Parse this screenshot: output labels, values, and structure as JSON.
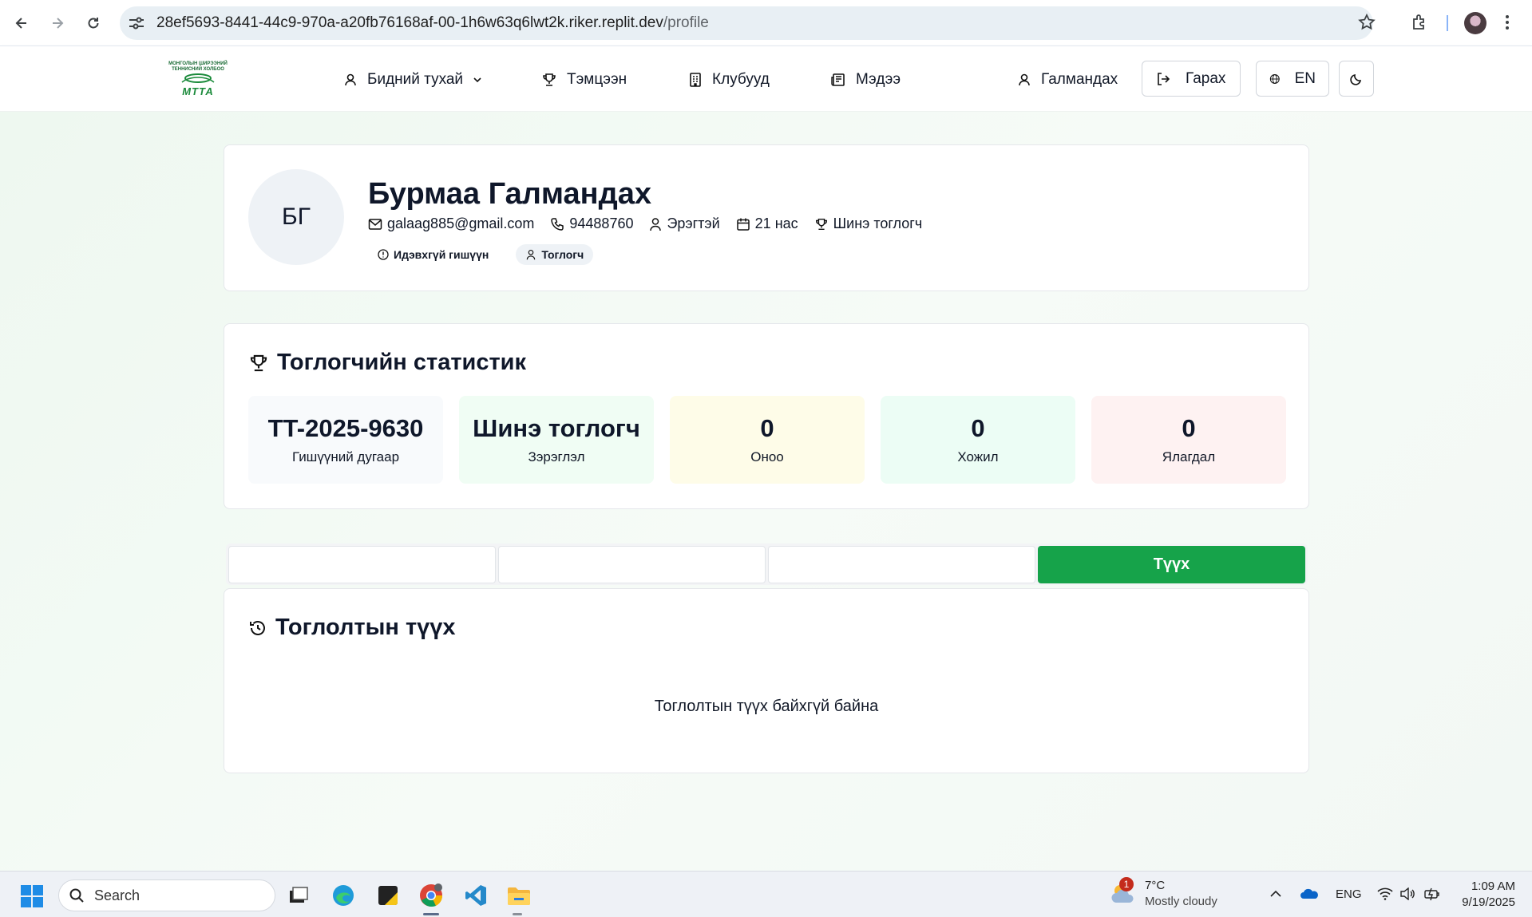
{
  "browser": {
    "url_host": "28ef5693-8441-44c9-970a-a20fb76168af-00-1h6w63q6lwt2k.riker.replit.dev",
    "url_path": "/profile"
  },
  "site": {
    "logo_text_line1": "МОНГОЛЫН ШИРЭЭНИЙ",
    "logo_text_line2": "ТЕННИСНИЙ ХОЛБОО",
    "logo_mark": "МТТА",
    "menu": {
      "about": "Бидний тухай",
      "tournaments": "Тэмцээн",
      "clubs": "Клубууд",
      "news": "Мэдээ"
    },
    "user_name": "Галмандах",
    "logout": "Гарах",
    "language": "EN"
  },
  "profile": {
    "initials": "БГ",
    "full_name": "Бурмаа Галмандах",
    "email": "galaag885@gmail.com",
    "phone": "94488760",
    "gender": "Эрэгтэй",
    "age": "21 нас",
    "rank": "Шинэ тоглогч",
    "status_badge": "Идэвхгүй гишүүн",
    "role_badge": "Тоглогч"
  },
  "stats": {
    "title": "Тоглогчийн статистик",
    "items": [
      {
        "value": "TT-2025-9630",
        "label": "Гишүүний дугаар",
        "color": "#f8fafc"
      },
      {
        "value": "Шинэ тоглогч",
        "label": "Зэрэглэл",
        "color": "#f0fdf4"
      },
      {
        "value": "0",
        "label": "Оноо",
        "color": "#fefce8"
      },
      {
        "value": "0",
        "label": "Хожил",
        "color": "#ecfdf5"
      },
      {
        "value": "0",
        "label": "Ялагдал",
        "color": "#fef2f2"
      }
    ]
  },
  "tabs": [
    "",
    "",
    "",
    "Түүх"
  ],
  "history": {
    "title": "Тоглолтын түүх",
    "empty": "Тоглолтын түүх байхгүй байна"
  },
  "taskbar": {
    "search_placeholder": "Search",
    "weather_temp": "7°C",
    "weather_desc": "Mostly cloudy",
    "weather_badge": "1",
    "lang": "ENG",
    "time": "1:09 AM",
    "date": "9/19/2025"
  },
  "colors": {
    "accent": "#16a34a"
  }
}
